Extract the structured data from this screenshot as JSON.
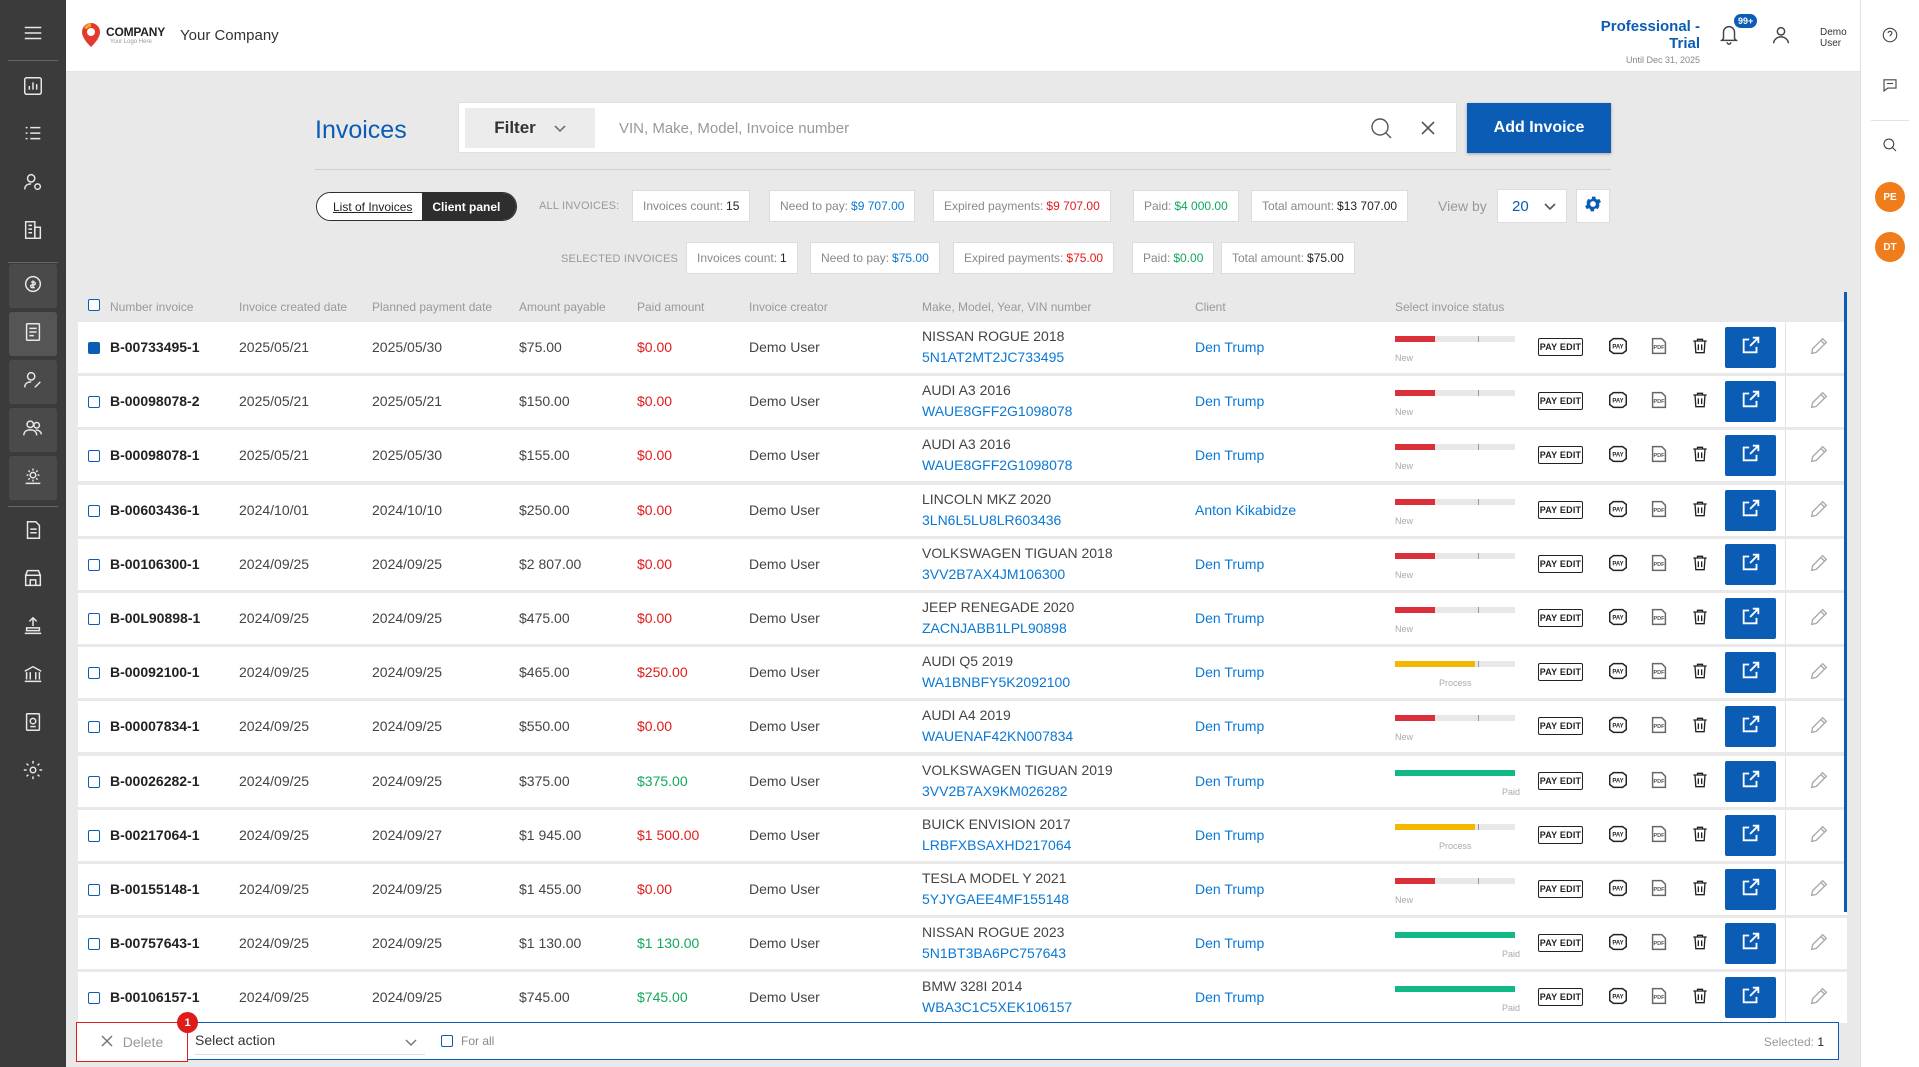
{
  "header": {
    "logo_text": "COMPANY",
    "logo_sub": "Your Logo Here",
    "company_name": "Your Company",
    "plan_title": "Professional - Trial",
    "plan_sub": "Until Dec 31, 2025",
    "notif_badge": "99+",
    "user_name_line1": "Demo",
    "user_name_line2": "User"
  },
  "rail": {
    "badge_pe": "PE",
    "badge_dt": "DT"
  },
  "page": {
    "title": "Invoices",
    "filter_label": "Filter",
    "search_placeholder": "VIN, Make, Model, Invoice number",
    "add_button": "Add Invoice"
  },
  "toggle": {
    "list": "List of Invoices",
    "client": "Client panel"
  },
  "all_stats": {
    "label": "ALL INVOICES:",
    "count_label": "Invoices count:",
    "count": "15",
    "need_label": "Need to pay:",
    "need": "$9 707.00",
    "expired_label": "Expired payments:",
    "expired": "$9 707.00",
    "paid_label": "Paid:",
    "paid": "$4 000.00",
    "total_label": "Total amount:",
    "total": "$13 707.00"
  },
  "selected_stats": {
    "label": "SELECTED INVOICES",
    "count_label": "Invoices count:",
    "count": "1",
    "need_label": "Need to pay:",
    "need": "$75.00",
    "expired_label": "Expired payments:",
    "expired": "$75.00",
    "paid_label": "Paid:",
    "paid": "$0.00",
    "total_label": "Total amount:",
    "total": "$75.00"
  },
  "view_by": {
    "label": "View by",
    "value": "20"
  },
  "columns": {
    "number": "Number invoice",
    "created": "Invoice created date",
    "planned": "Planned payment date",
    "amount": "Amount payable",
    "paid": "Paid amount",
    "creator": "Invoice creator",
    "vehicle": "Make, Model, Year, VIN number",
    "client": "Client",
    "status": "Select invoice status"
  },
  "actions": {
    "pay_edit": "PAY EDIT",
    "pay": "PAY",
    "pdf": "PDF"
  },
  "colors": {
    "new": "#d9303a",
    "process": "#f5b800",
    "paid": "#12b886"
  },
  "rows": [
    {
      "number": "B-00733495-1",
      "created": "2025/05/21",
      "planned": "2025/05/30",
      "amount": "$75.00",
      "paid": "$0.00",
      "paid_state": "red",
      "creator": "Demo User",
      "vehicle": "NISSAN ROGUE 2018",
      "vin": "5N1AT2MT2JC733495",
      "client": "Den Trump",
      "status": "New",
      "progress": 0.33,
      "checked": true
    },
    {
      "number": "B-00098078-2",
      "created": "2025/05/21",
      "planned": "2025/05/21",
      "amount": "$150.00",
      "paid": "$0.00",
      "paid_state": "red",
      "creator": "Demo User",
      "vehicle": "AUDI A3 2016",
      "vin": "WAUE8GFF2G1098078",
      "client": "Den Trump",
      "status": "New",
      "progress": 0.33,
      "checked": false
    },
    {
      "number": "B-00098078-1",
      "created": "2025/05/21",
      "planned": "2025/05/30",
      "amount": "$155.00",
      "paid": "$0.00",
      "paid_state": "red",
      "creator": "Demo User",
      "vehicle": "AUDI A3 2016",
      "vin": "WAUE8GFF2G1098078",
      "client": "Den Trump",
      "status": "New",
      "progress": 0.33,
      "checked": false
    },
    {
      "number": "B-00603436-1",
      "created": "2024/10/01",
      "planned": "2024/10/10",
      "amount": "$250.00",
      "paid": "$0.00",
      "paid_state": "red",
      "creator": "Demo User",
      "vehicle": "LINCOLN MKZ 2020",
      "vin": "3LN6L5LU8LR603436",
      "client": "Anton Kikabidze",
      "status": "New",
      "progress": 0.33,
      "checked": false
    },
    {
      "number": "B-00106300-1",
      "created": "2024/09/25",
      "planned": "2024/09/25",
      "amount": "$2 807.00",
      "paid": "$0.00",
      "paid_state": "red",
      "creator": "Demo User",
      "vehicle": "VOLKSWAGEN TIGUAN 2018",
      "vin": "3VV2B7AX4JM106300",
      "client": "Den Trump",
      "status": "New",
      "progress": 0.33,
      "checked": false
    },
    {
      "number": "B-00L90898-1",
      "created": "2024/09/25",
      "planned": "2024/09/25",
      "amount": "$475.00",
      "paid": "$0.00",
      "paid_state": "red",
      "creator": "Demo User",
      "vehicle": "JEEP RENEGADE 2020",
      "vin": "ZACNJABB1LPL90898",
      "client": "Den Trump",
      "status": "New",
      "progress": 0.33,
      "checked": false
    },
    {
      "number": "B-00092100-1",
      "created": "2024/09/25",
      "planned": "2024/09/25",
      "amount": "$465.00",
      "paid": "$250.00",
      "paid_state": "red",
      "creator": "Demo User",
      "vehicle": "AUDI Q5 2019",
      "vin": "WA1BNBFY5K2092100",
      "client": "Den Trump",
      "status": "Process",
      "progress": 0.67,
      "checked": false
    },
    {
      "number": "B-00007834-1",
      "created": "2024/09/25",
      "planned": "2024/09/25",
      "amount": "$550.00",
      "paid": "$0.00",
      "paid_state": "red",
      "creator": "Demo User",
      "vehicle": "AUDI A4 2019",
      "vin": "WAUENAF42KN007834",
      "client": "Den Trump",
      "status": "New",
      "progress": 0.33,
      "checked": false
    },
    {
      "number": "B-00026282-1",
      "created": "2024/09/25",
      "planned": "2024/09/25",
      "amount": "$375.00",
      "paid": "$375.00",
      "paid_state": "green",
      "creator": "Demo User",
      "vehicle": "VOLKSWAGEN TIGUAN 2019",
      "vin": "3VV2B7AX9KM026282",
      "client": "Den Trump",
      "status": "Paid",
      "progress": 1.0,
      "checked": false
    },
    {
      "number": "B-00217064-1",
      "created": "2024/09/25",
      "planned": "2024/09/27",
      "amount": "$1 945.00",
      "paid": "$1 500.00",
      "paid_state": "red",
      "creator": "Demo User",
      "vehicle": "BUICK ENVISION 2017",
      "vin": "LRBFXBSAXHD217064",
      "client": "Den Trump",
      "status": "Process",
      "progress": 0.67,
      "checked": false
    },
    {
      "number": "B-00155148-1",
      "created": "2024/09/25",
      "planned": "2024/09/25",
      "amount": "$1 455.00",
      "paid": "$0.00",
      "paid_state": "red",
      "creator": "Demo User",
      "vehicle": "TESLA MODEL Y 2021",
      "vin": "5YJYGAEE4MF155148",
      "client": "Den Trump",
      "status": "New",
      "progress": 0.33,
      "checked": false
    },
    {
      "number": "B-00757643-1",
      "created": "2024/09/25",
      "planned": "2024/09/25",
      "amount": "$1 130.00",
      "paid": "$1 130.00",
      "paid_state": "green",
      "creator": "Demo User",
      "vehicle": "NISSAN ROGUE 2023",
      "vin": "5N1BT3BA6PC757643",
      "client": "Den Trump",
      "status": "Paid",
      "progress": 1.0,
      "checked": false
    },
    {
      "number": "B-00106157-1",
      "created": "2024/09/25",
      "planned": "2024/09/25",
      "amount": "$745.00",
      "paid": "$745.00",
      "paid_state": "green",
      "creator": "Demo User",
      "vehicle": "BMW 328I 2014",
      "vin": "WBA3C1C5XEK106157",
      "client": "Den Trump",
      "status": "Paid",
      "progress": 1.0,
      "checked": false
    }
  ],
  "bottom": {
    "delete_label": "Delete",
    "error_count": "1",
    "action_label": "Select action",
    "for_all": "For all",
    "selected_label": "Selected:",
    "selected_count": "1"
  }
}
